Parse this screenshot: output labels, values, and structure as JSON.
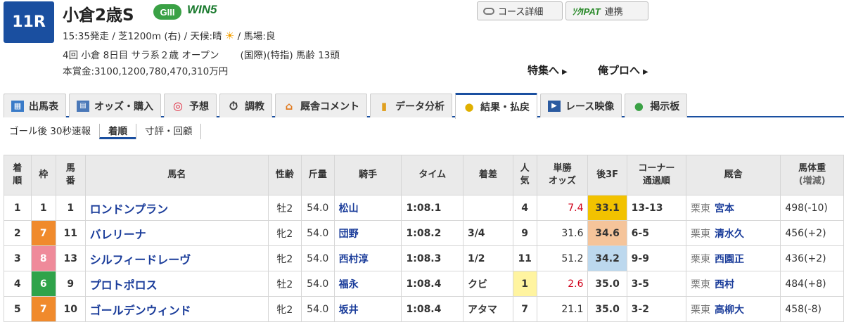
{
  "header": {
    "race_number": "11R",
    "race_name": "小倉2歳S",
    "grade": "GIII",
    "win5": "WIN5",
    "info_line1_before": "15:35発走 / 芝1200m (右) / 天候:晴",
    "info_line1_after": "/ 馬場:良",
    "weather_icon": "sun-icon",
    "info_line2_a": "4回 小倉 8日目 サラ系２歳 オープン",
    "info_line2_b": "(国際)(特指) 馬齢 13頭",
    "prize": "本賞金:3100,1200,780,470,310万円",
    "course_btn": "コース詳細",
    "ipat_brand": "ｿｸIPAT",
    "ipat_btn": "連携",
    "feature_link": "特集へ",
    "orepro_link": "俺プロへ"
  },
  "tabs": [
    {
      "label": "出馬表",
      "icon": "table-icon"
    },
    {
      "label": "オッズ・購入",
      "icon": "ipat-icon"
    },
    {
      "label": "予想",
      "icon": "target-icon"
    },
    {
      "label": "調教",
      "icon": "stopwatch-icon"
    },
    {
      "label": "厩舎コメント",
      "icon": "stable-icon"
    },
    {
      "label": "データ分析",
      "icon": "bar-chart-icon"
    },
    {
      "label": "結果・払戻",
      "icon": "coins-icon",
      "active": true
    },
    {
      "label": "レース映像",
      "icon": "video-icon"
    },
    {
      "label": "掲示板",
      "icon": "chat-icon"
    }
  ],
  "subtabs": [
    {
      "label": "ゴール後 30秒速報"
    },
    {
      "label": "着順",
      "active": true
    },
    {
      "label": "寸評・回顧"
    }
  ],
  "table": {
    "headers": {
      "rank": "着順",
      "waku": "枠",
      "umaban": "馬番",
      "name": "馬名",
      "sexage": "性齢",
      "weight": "斤量",
      "jockey": "騎手",
      "time": "タイム",
      "margin": "着差",
      "pop": "人気",
      "odds": "単勝オッズ",
      "last3f": "後3F",
      "corner": "コーナー通過順",
      "trainer": "厩舎",
      "body": "馬体重(増減)"
    },
    "rows": [
      {
        "rank": "1",
        "waku": "1",
        "waku_color": "#ffffff",
        "waku_text": "#333333",
        "umaban": "1",
        "name": "ロンドンプラン",
        "sexage": "牡2",
        "weight": "54.0",
        "jockey": "松山",
        "time": "1:08.1",
        "margin": "",
        "pop": "4",
        "pop_bg": "",
        "odds": "7.4",
        "odds_red": true,
        "last3f": "33.1",
        "last3f_bg": "#f2c200",
        "corner": "13-13",
        "trainer_pref": "栗東",
        "trainer": "宮本",
        "body": "498(-10)"
      },
      {
        "rank": "2",
        "waku": "7",
        "waku_color": "#f08a2c",
        "waku_text": "#ffffff",
        "umaban": "11",
        "name": "バレリーナ",
        "sexage": "牝2",
        "weight": "54.0",
        "jockey": "団野",
        "time": "1:08.2",
        "margin": "3/4",
        "pop": "9",
        "pop_bg": "",
        "odds": "31.6",
        "odds_red": false,
        "last3f": "34.6",
        "last3f_bg": "#f5c49a",
        "corner": "6-5",
        "trainer_pref": "栗東",
        "trainer": "清水久",
        "body": "456(+2)"
      },
      {
        "rank": "3",
        "waku": "8",
        "waku_color": "#ef8a9a",
        "waku_text": "#ffffff",
        "umaban": "13",
        "name": "シルフィードレーヴ",
        "sexage": "牝2",
        "weight": "54.0",
        "jockey": "西村淳",
        "time": "1:08.3",
        "margin": "1/2",
        "pop": "11",
        "pop_bg": "",
        "odds": "51.2",
        "odds_red": false,
        "last3f": "34.2",
        "last3f_bg": "#bcd8ee",
        "corner": "9-9",
        "trainer_pref": "栗東",
        "trainer": "西園正",
        "body": "436(+2)"
      },
      {
        "rank": "4",
        "waku": "6",
        "waku_color": "#2fa34a",
        "waku_text": "#ffffff",
        "umaban": "9",
        "name": "プロトポロス",
        "sexage": "牡2",
        "weight": "54.0",
        "jockey": "福永",
        "time": "1:08.4",
        "margin": "クビ",
        "pop": "1",
        "pop_bg": "#fff4a0",
        "odds": "2.6",
        "odds_red": true,
        "last3f": "35.0",
        "last3f_bg": "",
        "corner": "3-5",
        "trainer_pref": "栗東",
        "trainer": "西村",
        "body": "484(+8)"
      },
      {
        "rank": "5",
        "waku": "7",
        "waku_color": "#f08a2c",
        "waku_text": "#ffffff",
        "umaban": "10",
        "name": "ゴールデンウィンド",
        "sexage": "牝2",
        "weight": "54.0",
        "jockey": "坂井",
        "time": "1:08.4",
        "margin": "アタマ",
        "pop": "7",
        "pop_bg": "",
        "odds": "21.1",
        "odds_red": false,
        "last3f": "35.0",
        "last3f_bg": "",
        "corner": "3-2",
        "trainer_pref": "栗東",
        "trainer": "高柳大",
        "body": "458(-8)"
      }
    ]
  },
  "colors": {
    "accent": "#1a4fa0",
    "grade_green": "#3aa145",
    "link_blue": "#1a3c9a"
  }
}
